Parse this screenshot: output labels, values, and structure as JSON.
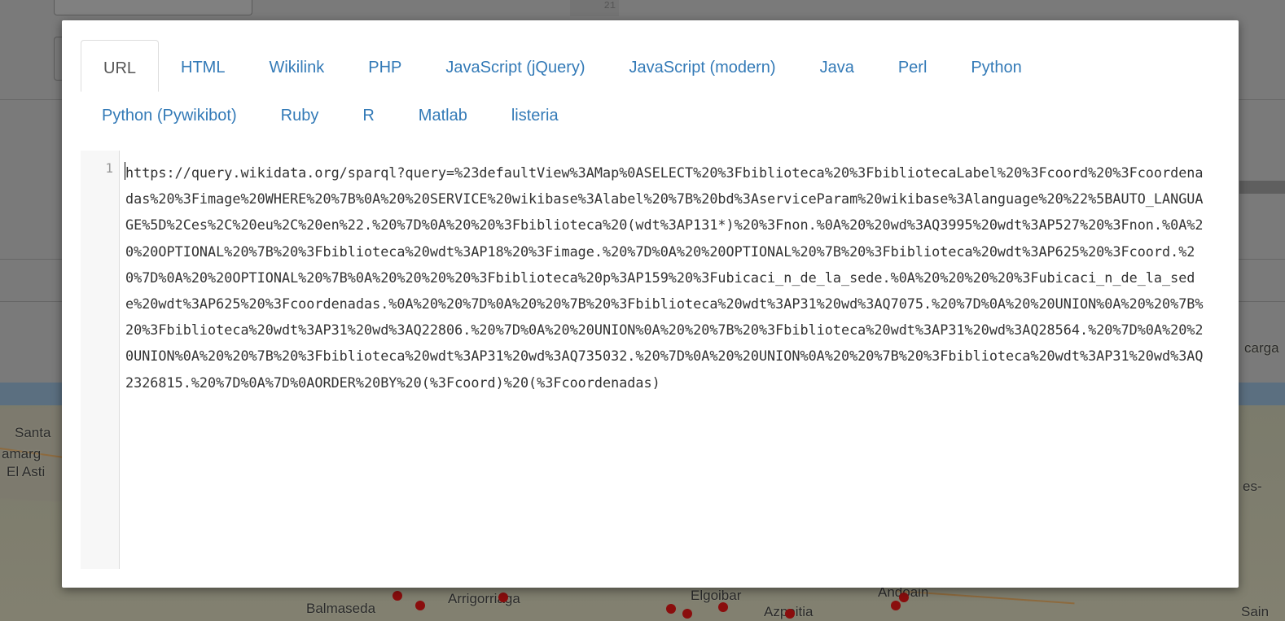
{
  "background": {
    "gutter_line_number": "21",
    "map_labels": [
      "Santa",
      "amarg",
      "El Asti",
      "Balmaseda",
      "Arrigorriaga",
      "Elgoibar",
      "Azpeitia",
      "Andoain",
      "Sain",
      "es-",
      "carga"
    ]
  },
  "modal": {
    "tabs_row1": [
      {
        "label": "URL",
        "active": true
      },
      {
        "label": "HTML",
        "active": false
      },
      {
        "label": "Wikilink",
        "active": false
      },
      {
        "label": "PHP",
        "active": false
      },
      {
        "label": "JavaScript (jQuery)",
        "active": false
      },
      {
        "label": "JavaScript (modern)",
        "active": false
      },
      {
        "label": "Java",
        "active": false
      },
      {
        "label": "Perl",
        "active": false
      },
      {
        "label": "Python",
        "active": false
      }
    ],
    "tabs_row2": [
      {
        "label": "Python (Pywikibot)",
        "active": false
      },
      {
        "label": "Ruby",
        "active": false
      },
      {
        "label": "R",
        "active": false
      },
      {
        "label": "Matlab",
        "active": false
      },
      {
        "label": "listeria",
        "active": false
      }
    ],
    "editor": {
      "line_number": "1",
      "code": "https://query.wikidata.org/sparql?query=%23defaultView%3AMap%0ASELECT%20%3Fbiblioteca%20%3FbibliotecaLabel%20%3Fcoord%20%3Fcoordenadas%20%3Fimage%20WHERE%20%7B%0A%20%20SERVICE%20wikibase%3Alabel%20%7B%20bd%3AserviceParam%20wikibase%3Alanguage%20%22%5BAUTO_LANGUAGE%5D%2Ces%2C%20eu%2C%20en%22.%20%7D%0A%20%20%3Fbiblioteca%20(wdt%3AP131*)%20%3Fnon.%0A%20%20wd%3AQ3995%20wdt%3AP527%20%3Fnon.%0A%20%20OPTIONAL%20%7B%20%3Fbiblioteca%20wdt%3AP18%20%3Fimage.%20%7D%0A%20%20OPTIONAL%20%7B%20%3Fbiblioteca%20wdt%3AP625%20%3Fcoord.%20%7D%0A%20%20OPTIONAL%20%7B%0A%20%20%20%20%3Fbiblioteca%20p%3AP159%20%3Fubicaci_n_de_la_sede.%0A%20%20%20%20%3Fubicaci_n_de_la_sede%20wdt%3AP625%20%3Fcoordenadas.%0A%20%20%7D%0A%20%20%7B%20%3Fbiblioteca%20wdt%3AP31%20wd%3AQ7075.%20%7D%0A%20%20UNION%0A%20%20%7B%20%3Fbiblioteca%20wdt%3AP31%20wd%3AQ22806.%20%7D%0A%20%20UNION%0A%20%20%7B%20%3Fbiblioteca%20wdt%3AP31%20wd%3AQ28564.%20%7D%0A%20%20UNION%0A%20%20%7B%20%3Fbiblioteca%20wdt%3AP31%20wd%3AQ735032.%20%7D%0A%20%20UNION%0A%20%20%7B%20%3Fbiblioteca%20wdt%3AP31%20wd%3AQ2326815.%20%7D%0A%7D%0AORDER%20BY%20(%3Fcoord)%20(%3Fcoordenadas)"
    }
  },
  "colors": {
    "tab_link": "#337ab7",
    "tab_active": "#555555",
    "map_marker": "#8a0d0d"
  }
}
